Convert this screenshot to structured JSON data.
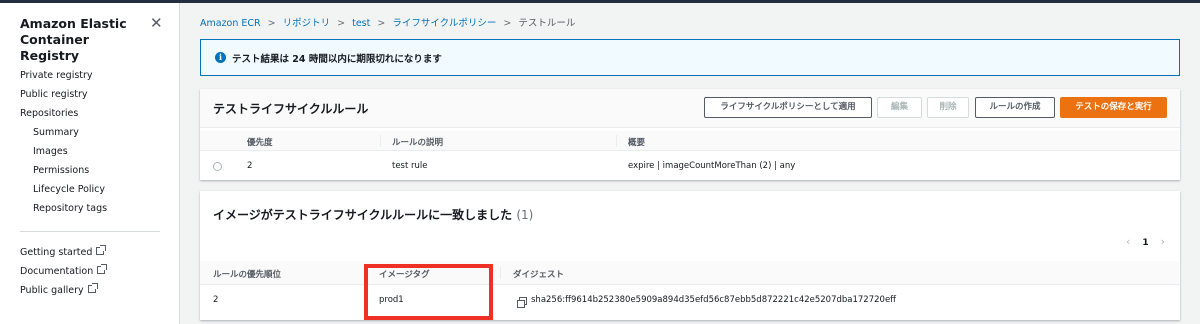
{
  "sidebar": {
    "title": "Amazon Elastic Container Registry",
    "items": [
      {
        "label": "Private registry"
      },
      {
        "label": "Public registry"
      },
      {
        "label": "Repositories"
      },
      {
        "label": "Summary"
      },
      {
        "label": "Images"
      },
      {
        "label": "Permissions"
      },
      {
        "label": "Lifecycle Policy"
      },
      {
        "label": "Repository tags"
      }
    ],
    "links": [
      {
        "label": "Getting started"
      },
      {
        "label": "Documentation"
      },
      {
        "label": "Public gallery"
      }
    ]
  },
  "breadcrumb": [
    "Amazon ECR",
    "リポジトリ",
    "test",
    "ライフサイクルポリシー",
    "テストルール"
  ],
  "alert": {
    "message": "テスト結果は 24 時間以内に期限切れになります",
    "color": "#0073bb"
  },
  "rules_panel": {
    "title": "テストライフサイクルルール",
    "buttons": {
      "apply": "ライフサイクルポリシーとして適用",
      "edit": "編集",
      "delete": "削除",
      "create": "ルールの作成",
      "save_run": "テストの保存と実行"
    },
    "columns": [
      "優先度",
      "ルールの説明",
      "概要"
    ],
    "rows": [
      {
        "priority": "2",
        "description": "test rule",
        "summary": "expire | imageCountMoreThan (2) | any"
      }
    ]
  },
  "match_panel": {
    "title": "イメージがテストライフサイクルルールに一致しました",
    "count": "(1)",
    "page": "1",
    "columns": [
      "ルールの優先順位",
      "イメージタグ",
      "ダイジェスト"
    ],
    "rows": [
      {
        "priority": "2",
        "tag": "prod1",
        "digest": "sha256:ff9614b252380e5909a894d35efd56c87ebb5d872221c42e5207dba172720eff"
      }
    ]
  },
  "colors": {
    "primary_button": "#ec7211",
    "link": "#0073bb",
    "highlight": "#ee3124"
  }
}
